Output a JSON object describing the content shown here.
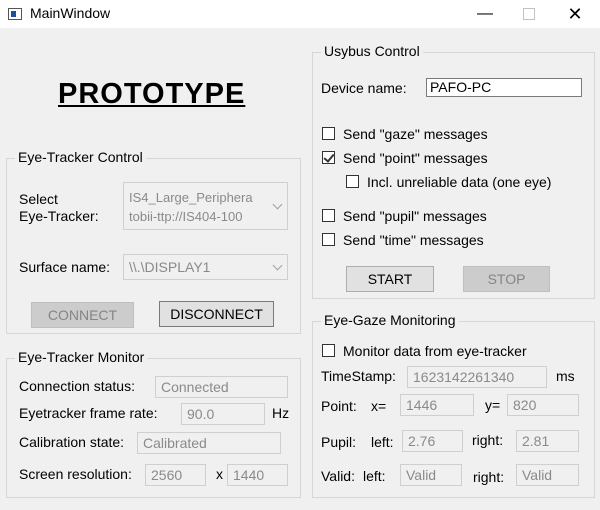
{
  "window": {
    "title": "MainWindow",
    "minimize": "—",
    "close": "✕"
  },
  "prototype_heading": "PROTOTYPE",
  "eye_tracker_control": {
    "title": "Eye-Tracker Control",
    "select_label_line1": "Select",
    "select_label_line2": "Eye-Tracker:",
    "tracker_line1": "IS4_Large_Periphera",
    "tracker_line2": "tobii-ttp://IS404-100",
    "surface_label": "Surface name:",
    "surface_value": "\\\\.\\DISPLAY1",
    "connect": "CONNECT",
    "disconnect": "DISCONNECT"
  },
  "eye_tracker_monitor": {
    "title": "Eye-Tracker Monitor",
    "connection_status_label": "Connection status:",
    "connection_status_value": "Connected",
    "frame_rate_label": "Eyetracker frame rate:",
    "frame_rate_value": "90.0",
    "frame_rate_unit": "Hz",
    "calibration_label": "Calibration state:",
    "calibration_value": "Calibrated",
    "resolution_label": "Screen resolution:",
    "resolution_w": "2560",
    "resolution_x": "x",
    "resolution_h": "1440"
  },
  "usybus_control": {
    "title": "Usybus Control",
    "device_label": "Device name:",
    "device_value": "PAFO-PC",
    "send_gaze": {
      "label": "Send \"gaze\" messages",
      "checked": false
    },
    "send_point": {
      "label": "Send \"point\" messages",
      "checked": true
    },
    "incl_unreliable": {
      "label": "Incl. unreliable data (one eye)",
      "checked": false
    },
    "send_pupil": {
      "label": "Send \"pupil\" messages",
      "checked": false
    },
    "send_time": {
      "label": "Send \"time\" messages",
      "checked": false
    },
    "start": "START",
    "stop": "STOP"
  },
  "eye_gaze_monitoring": {
    "title": "Eye-Gaze Monitoring",
    "monitor_label": "Monitor data from eye-tracker",
    "monitor_checked": false,
    "timestamp_label": "TimeStamp:",
    "timestamp_value": "1623142261340",
    "timestamp_unit": "ms",
    "point_label": "Point:",
    "x_label": "x=",
    "x_value": "1446",
    "y_label": "y=",
    "y_value": "820",
    "pupil_label": "Pupil:",
    "pupil_left_label": "left:",
    "pupil_left_value": "2.76",
    "pupil_right_label": "right:",
    "pupil_right_value": "2.81",
    "valid_label": "Valid:",
    "valid_left_label": "left:",
    "valid_left_value": "Valid",
    "valid_right_label": "right:",
    "valid_right_value": "Valid"
  }
}
